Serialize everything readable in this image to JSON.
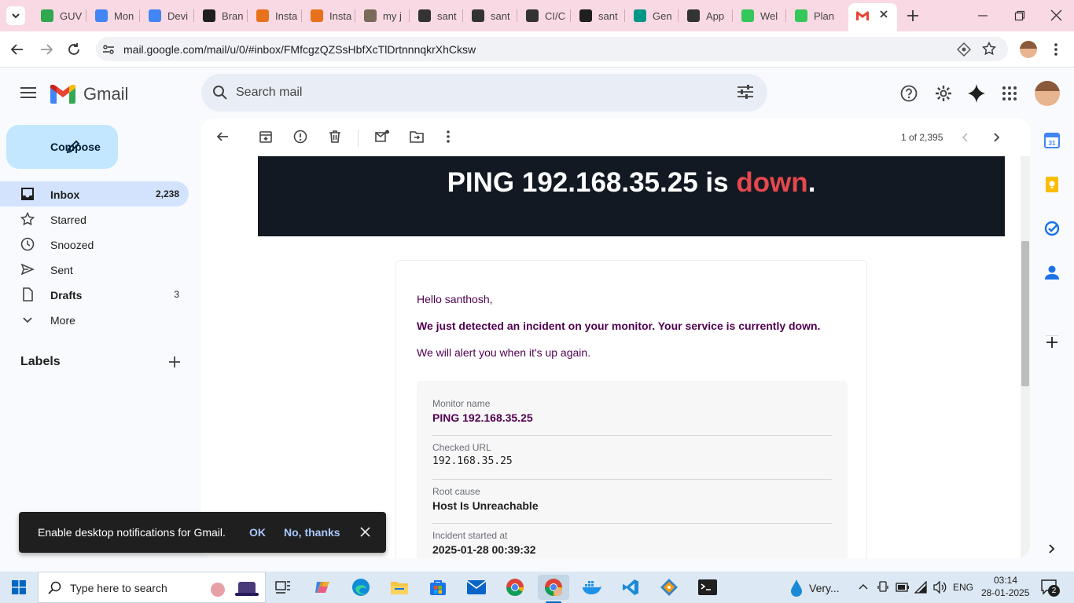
{
  "browser": {
    "tabs": [
      {
        "label": "GUV",
        "icon": "guvi-icon",
        "color": "#2fa84f"
      },
      {
        "label": "Mon",
        "icon": "docs-icon",
        "color": "#4285f4"
      },
      {
        "label": "Devi",
        "icon": "docs-icon",
        "color": "#4285f4"
      },
      {
        "label": "Bran",
        "icon": "github-icon",
        "color": "#1f1f1f"
      },
      {
        "label": "Insta",
        "icon": "aws-icon",
        "color": "#e8711b"
      },
      {
        "label": "Insta",
        "icon": "aws-icon",
        "color": "#e8711b"
      },
      {
        "label": "my j",
        "icon": "avatar-icon",
        "color": "#7a6a5a"
      },
      {
        "label": "sant",
        "icon": "chatgpt-icon",
        "color": "#333333"
      },
      {
        "label": "sant",
        "icon": "chatgpt-icon",
        "color": "#333333"
      },
      {
        "label": "CI/C",
        "icon": "openai-icon",
        "color": "#333333"
      },
      {
        "label": "sant",
        "icon": "github-icon",
        "color": "#1f1f1f"
      },
      {
        "label": "Gen",
        "icon": "diamond-icon",
        "color": "#009688"
      },
      {
        "label": "App",
        "icon": "openai-icon",
        "color": "#333333"
      },
      {
        "label": "Wel",
        "icon": "green-dot-icon",
        "color": "#34c759"
      },
      {
        "label": "Plan",
        "icon": "green-dot-icon",
        "color": "#34c759"
      }
    ],
    "url": "mail.google.com/mail/u/0/#inbox/FMfcgzQZSsHbfXcTlDrtnnnqkrXhCksw"
  },
  "gmail": {
    "logo_text": "Gmail",
    "search_placeholder": "Search mail",
    "compose_label": "Compose",
    "nav": [
      {
        "label": "Inbox",
        "count": "2,238"
      },
      {
        "label": "Starred",
        "count": ""
      },
      {
        "label": "Snoozed",
        "count": ""
      },
      {
        "label": "Sent",
        "count": ""
      },
      {
        "label": "Drafts",
        "count": "3"
      },
      {
        "label": "More",
        "count": ""
      }
    ],
    "labels_heading": "Labels",
    "pager": "1 of 2,395"
  },
  "email": {
    "banner_prefix": "PING 192.168.35.25 is ",
    "banner_status": "down",
    "banner_suffix": ".",
    "greeting": "Hello santhosh,",
    "alert": "We just detected an incident on your monitor. Your service is currently down.",
    "followup": "We will alert you when it's up again.",
    "details": [
      {
        "label": "Monitor name",
        "value": "PING 192.168.35.25"
      },
      {
        "label": "Checked URL",
        "value": "192.168.35.25"
      },
      {
        "label": "Root cause",
        "value": "Host Is Unreachable"
      },
      {
        "label": "Incident started at",
        "value": "2025-01-28 00:39:32"
      }
    ]
  },
  "snackbar": {
    "text": "Enable desktop notifications for Gmail.",
    "ok": "OK",
    "no": "No, thanks"
  },
  "taskbar": {
    "search_placeholder": "Type here to search",
    "weather": "Very...",
    "lang": "ENG",
    "time": "03:14",
    "date": "28-01-2025",
    "notif_count": "2"
  },
  "colors": {
    "accent": "#c2e7ff",
    "down": "#e5484d",
    "banner_bg": "#121922",
    "email_text": "#500050"
  }
}
